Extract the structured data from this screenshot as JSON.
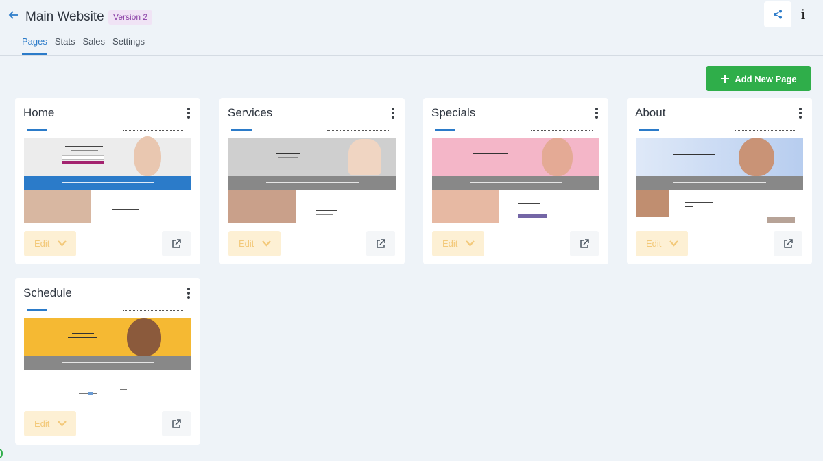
{
  "header": {
    "title": "Main Website",
    "version": "Version 2",
    "tabs": [
      {
        "label": "Pages",
        "active": true
      },
      {
        "label": "Stats",
        "active": false
      },
      {
        "label": "Sales",
        "active": false
      },
      {
        "label": "Settings",
        "active": false
      }
    ],
    "info_label": "i"
  },
  "actions": {
    "add_page_label": "Add New Page"
  },
  "cards": [
    {
      "title": "Home",
      "edit_label": "Edit"
    },
    {
      "title": "Services",
      "edit_label": "Edit"
    },
    {
      "title": "Specials",
      "edit_label": "Edit"
    },
    {
      "title": "About",
      "edit_label": "Edit"
    },
    {
      "title": "Schedule",
      "edit_label": "Edit"
    }
  ],
  "colors": {
    "accent": "#2b7bc9",
    "add_button": "#2fae4a",
    "edit_button_bg": "#fdf0d4",
    "badge_bg": "#f0e3f5",
    "badge_text": "#8a3fa6"
  }
}
